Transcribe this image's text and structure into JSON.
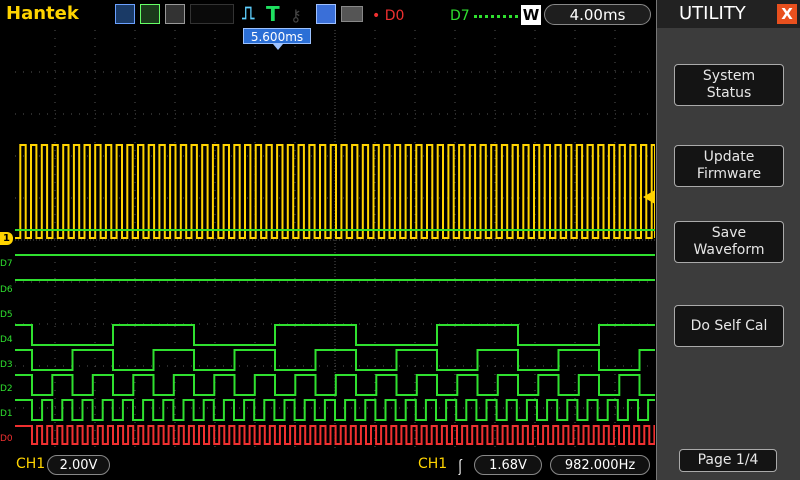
{
  "topbar": {
    "brand": "Hantek",
    "trigger_status": "T",
    "d0_label": "D0",
    "d7_label": "D7",
    "w_label": "W",
    "timebase": "4.00ms"
  },
  "screen": {
    "trigger_position": "5.600ms",
    "ch1_marker": "1",
    "digital_labels": [
      "D7",
      "D6",
      "D5",
      "D4",
      "D3",
      "D2",
      "D1",
      "D0"
    ]
  },
  "bottom": {
    "ch1_label": "CH1",
    "volts_div": "2.00V",
    "trig_source": "CH1",
    "trig_level": "1.68V",
    "frequency": "982.000Hz"
  },
  "panel": {
    "title": "UTILITY",
    "close": "X",
    "buttons": [
      "System\nStatus",
      "Update\nFirmware",
      "Save\nWaveform",
      "Do Self Cal"
    ],
    "page": "Page 1/4"
  },
  "colors": {
    "ch1": "#ffd400",
    "digital": "#2fe02f",
    "d0": "#f03030",
    "accent_blue": "#2b6fd6",
    "panel_bg": "#3c3c3c"
  }
}
